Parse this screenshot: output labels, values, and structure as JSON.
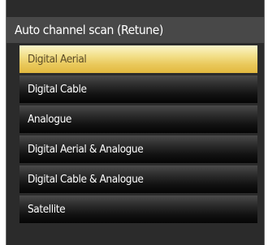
{
  "menu": {
    "title": "Auto channel scan (Retune)",
    "items": [
      {
        "label": "Digital Aerial"
      },
      {
        "label": "Digital Cable"
      },
      {
        "label": "Analogue"
      },
      {
        "label": "Digital Aerial & Analogue"
      },
      {
        "label": "Digital Cable & Analogue"
      },
      {
        "label": "Satellite"
      }
    ]
  },
  "colors": {
    "highlight": "#f0d873",
    "panel": "#2b2b2b",
    "title_bar": "#484848"
  }
}
